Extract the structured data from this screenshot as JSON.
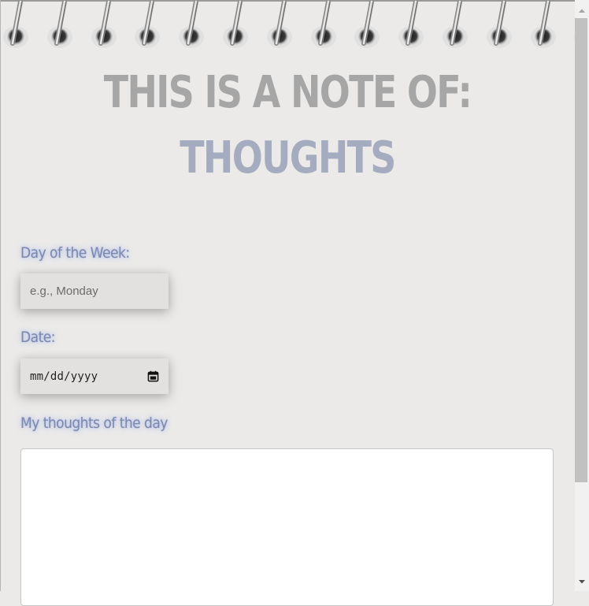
{
  "header": {
    "title_line1": "THIS IS A NOTE OF:",
    "title_line2": "THOUGHTS"
  },
  "form": {
    "day_label": "Day of the Week:",
    "day_placeholder": "e.g., Monday",
    "date_label": "Date:",
    "date_format": "mm/dd/yyyy",
    "thoughts_label": "My thoughts of the day",
    "thoughts_value": ""
  },
  "icons": {
    "calendar": "calendar-icon",
    "scroll_up": "chevron-up-icon",
    "scroll_down": "chevron-down-icon",
    "ring": "spiral-ring-icon"
  },
  "colors": {
    "background": "#ebeae9",
    "title_line1": "#a6a6a6",
    "title_line2": "#a6acbf",
    "label": "#7c89ac",
    "input_bg": "#e2e1e0"
  }
}
